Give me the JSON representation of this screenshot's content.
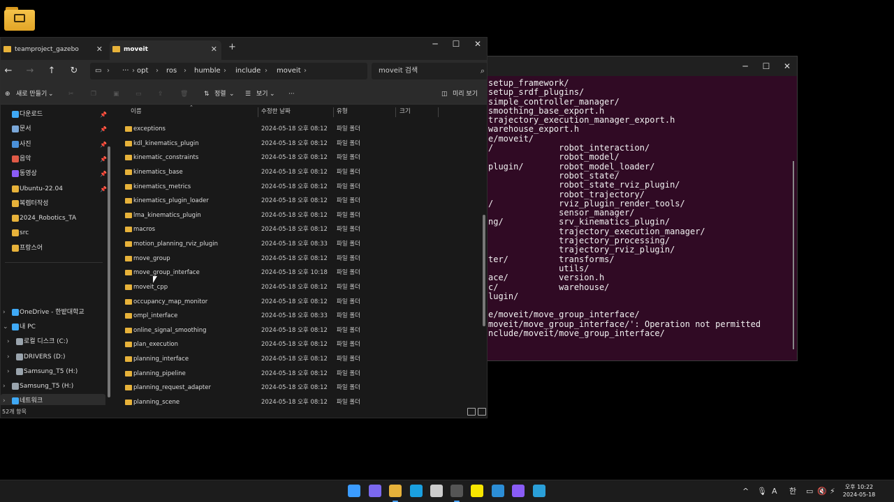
{
  "terminal": {
    "lines": [
      "setup_framework/",
      "setup_srdf_plugins/",
      "simple_controller_manager/",
      "smoothing_base_export.h",
      "trajectory_execution_manager_export.h",
      "warehouse_export.h",
      "e/moveit/",
      "/             robot_interaction/",
      "              robot_model/",
      "plugin/       robot_model_loader/",
      "              robot_state/",
      "              robot_state_rviz_plugin/",
      "              robot_trajectory/",
      "/             rviz_plugin_render_tools/",
      "              sensor_manager/",
      "ng/           srv_kinematics_plugin/",
      "              trajectory_execution_manager/",
      "              trajectory_processing/",
      "              trajectory_rviz_plugin/",
      "ter/          transforms/",
      "              utils/",
      "ace/          version.h",
      "c/            warehouse/",
      "lugin/",
      "",
      "e/moveit/move_group_interface/",
      "moveit/move_group_interface/': Operation not permitted",
      "nclude/moveit/move_group_interface/"
    ],
    "controls": {
      "minimize": "─",
      "maximize": "☐",
      "close": "✕"
    }
  },
  "explorer": {
    "tabs": [
      {
        "label": "teamproject_gazebo",
        "close": "✕"
      },
      {
        "label": "moveit",
        "close": "✕"
      }
    ],
    "new_tab": "+",
    "window_controls": {
      "minimize": "─",
      "maximize": "☐",
      "close": "✕"
    },
    "nav": {
      "back": "←",
      "forward": "→",
      "up": "↑",
      "refresh": "↻"
    },
    "breadcrumb": {
      "monitor_icon": "▭",
      "more": "···",
      "segments": [
        "opt",
        "ros",
        "humble",
        "include",
        "moveit"
      ],
      "separator": "›"
    },
    "search": {
      "placeholder": "moveit 검색",
      "icon": "⌕"
    },
    "toolbar": {
      "new_label": "새로 만들기",
      "sort_label": "정렬",
      "view_label": "보기",
      "more": "···",
      "preview_label": "미리 보기",
      "chevron": "⌄"
    },
    "sidebar": {
      "quick": [
        {
          "label": "다운로드",
          "icon_color": "#3fa9f5",
          "pinned": true
        },
        {
          "label": "문서",
          "icon_color": "#7aa7d8",
          "pinned": true
        },
        {
          "label": "사진",
          "icon_color": "#4a90d9",
          "pinned": true
        },
        {
          "label": "음악",
          "icon_color": "#e05a47",
          "pinned": true
        },
        {
          "label": "동영상",
          "icon_color": "#8b5cf6",
          "pinned": true
        },
        {
          "label": "Ubuntu-22.04",
          "icon_color": "#e7b23a",
          "pinned": true
        },
        {
          "label": "복렙터작성",
          "icon_color": "#e7b23a",
          "pinned": false
        },
        {
          "label": "2024_Robotics_TA",
          "icon_color": "#e7b23a",
          "pinned": false
        },
        {
          "label": "src",
          "icon_color": "#e7b23a",
          "pinned": false
        },
        {
          "label": "프랑스어",
          "icon_color": "#e7b23a",
          "pinned": false
        }
      ],
      "pin_glyph": "📌",
      "tree": [
        {
          "label": "OneDrive - 한밭대학교",
          "icon_color": "#3fa9f5",
          "chevron": "›"
        },
        {
          "label": "내 PC",
          "icon_color": "#3fa9f5",
          "chevron": "⌄"
        },
        {
          "label": "로컬 디스크 (C:)",
          "icon_color": "#9aa4ad",
          "chevron": "›"
        },
        {
          "label": "DRIVERS (D:)",
          "icon_color": "#9aa4ad",
          "chevron": "›"
        },
        {
          "label": "Samsung_T5 (H:)",
          "icon_color": "#9aa4ad",
          "chevron": "›"
        },
        {
          "label": "Samsung_T5 (H:)",
          "icon_color": "#9aa4ad",
          "chevron": "›"
        },
        {
          "label": "네트워크",
          "icon_color": "#3fa9f5",
          "chevron": "›"
        }
      ]
    },
    "columns": {
      "name": "이름",
      "modified": "수정한 날짜",
      "type": "유형",
      "size": "크기",
      "sort_glyph": "⌃"
    },
    "files": [
      {
        "name": "exceptions",
        "date": "2024-05-18 오후 08:12",
        "type": "파일 폴더"
      },
      {
        "name": "kdl_kinematics_plugin",
        "date": "2024-05-18 오후 08:12",
        "type": "파일 폴더"
      },
      {
        "name": "kinematic_constraints",
        "date": "2024-05-18 오후 08:12",
        "type": "파일 폴더"
      },
      {
        "name": "kinematics_base",
        "date": "2024-05-18 오후 08:12",
        "type": "파일 폴더"
      },
      {
        "name": "kinematics_metrics",
        "date": "2024-05-18 오후 08:12",
        "type": "파일 폴더"
      },
      {
        "name": "kinematics_plugin_loader",
        "date": "2024-05-18 오후 08:12",
        "type": "파일 폴더"
      },
      {
        "name": "lma_kinematics_plugin",
        "date": "2024-05-18 오후 08:12",
        "type": "파일 폴더"
      },
      {
        "name": "macros",
        "date": "2024-05-18 오후 08:12",
        "type": "파일 폴더"
      },
      {
        "name": "motion_planning_rviz_plugin",
        "date": "2024-05-18 오후 08:33",
        "type": "파일 폴더"
      },
      {
        "name": "move_group",
        "date": "2024-05-18 오후 08:12",
        "type": "파일 폴더"
      },
      {
        "name": "move_group_interface",
        "date": "2024-05-18 오후 10:18",
        "type": "파일 폴더"
      },
      {
        "name": "moveit_cpp",
        "date": "2024-05-18 오후 08:12",
        "type": "파일 폴더"
      },
      {
        "name": "occupancy_map_monitor",
        "date": "2024-05-18 오후 08:12",
        "type": "파일 폴더"
      },
      {
        "name": "ompl_interface",
        "date": "2024-05-18 오후 08:33",
        "type": "파일 폴더"
      },
      {
        "name": "online_signal_smoothing",
        "date": "2024-05-18 오후 08:12",
        "type": "파일 폴더"
      },
      {
        "name": "plan_execution",
        "date": "2024-05-18 오후 08:12",
        "type": "파일 폴더"
      },
      {
        "name": "planning_interface",
        "date": "2024-05-18 오후 08:12",
        "type": "파일 폴더"
      },
      {
        "name": "planning_pipeline",
        "date": "2024-05-18 오후 08:12",
        "type": "파일 폴더"
      },
      {
        "name": "planning_request_adapter",
        "date": "2024-05-18 오후 08:12",
        "type": "파일 폴더"
      },
      {
        "name": "planning_scene",
        "date": "2024-05-18 오후 08:12",
        "type": "파일 폴더"
      }
    ],
    "status": {
      "item_count": "52개 항목"
    }
  },
  "taskbar": {
    "apps": [
      {
        "name": "start-button",
        "color": "#3b9cff"
      },
      {
        "name": "copilot",
        "color": "#7b68ee"
      },
      {
        "name": "file-explorer",
        "color": "#e7b23a",
        "active": true
      },
      {
        "name": "edge",
        "color": "#1aa0e0"
      },
      {
        "name": "apple-app",
        "color": "#cccccc"
      },
      {
        "name": "terminal",
        "color": "#555555",
        "active": true
      },
      {
        "name": "kakaotalk",
        "color": "#f7e600"
      },
      {
        "name": "vscode",
        "color": "#2c8ed6"
      },
      {
        "name": "clipchamp",
        "color": "#8a5cf6"
      },
      {
        "name": "photos",
        "color": "#2a9fd8"
      }
    ],
    "tray": {
      "chevron": "^",
      "ime": "A",
      "lang": "한",
      "volume": "🔇"
    },
    "clock": {
      "time": "오후 10:22",
      "date": "2024-05-18"
    }
  }
}
